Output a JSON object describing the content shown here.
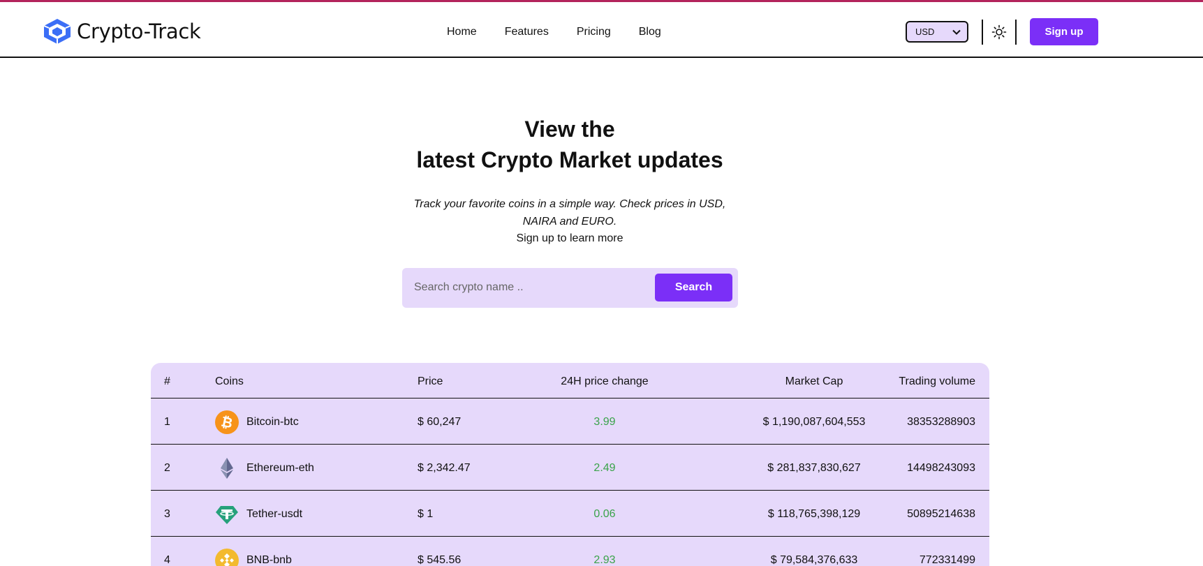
{
  "brand": {
    "name": "Crypto-Track"
  },
  "nav": {
    "links": [
      "Home",
      "Features",
      "Pricing",
      "Blog"
    ],
    "currency": "USD",
    "signup": "Sign up"
  },
  "hero": {
    "title_line1": "View the",
    "title_line2": "latest Crypto Market updates",
    "subtitle": "Track your favorite coins in a simple way. Check prices in USD, NAIRA and EURO.",
    "cta": "Sign up to learn more"
  },
  "search": {
    "placeholder": "Search crypto name ..",
    "button": "Search"
  },
  "table": {
    "headers": [
      "#",
      "Coins",
      "Price",
      "24H price change",
      "Market Cap",
      "Trading volume"
    ],
    "rows": [
      {
        "rank": "1",
        "coin": "Bitcoin-btc",
        "price": "$ 60,247",
        "change": "3.99",
        "market_cap": "$ 1,190,087,604,553",
        "volume": "38353288903",
        "icon": "bitcoin-icon"
      },
      {
        "rank": "2",
        "coin": "Ethereum-eth",
        "price": "$ 2,342.47",
        "change": "2.49",
        "market_cap": "$ 281,837,830,627",
        "volume": "14498243093",
        "icon": "ethereum-icon"
      },
      {
        "rank": "3",
        "coin": "Tether-usdt",
        "price": "$ 1",
        "change": "0.06",
        "market_cap": "$ 118,765,398,129",
        "volume": "50895214638",
        "icon": "tether-icon"
      },
      {
        "rank": "4",
        "coin": "BNB-bnb",
        "price": "$ 545.56",
        "change": "2.93",
        "market_cap": "$ 79,584,376,633",
        "volume": "772331499",
        "icon": "bnb-icon"
      }
    ]
  },
  "colors": {
    "accent": "#7b2ff7",
    "panel": "#e6d9fb",
    "positive": "#3aa34a",
    "topline": "#b3245c"
  }
}
